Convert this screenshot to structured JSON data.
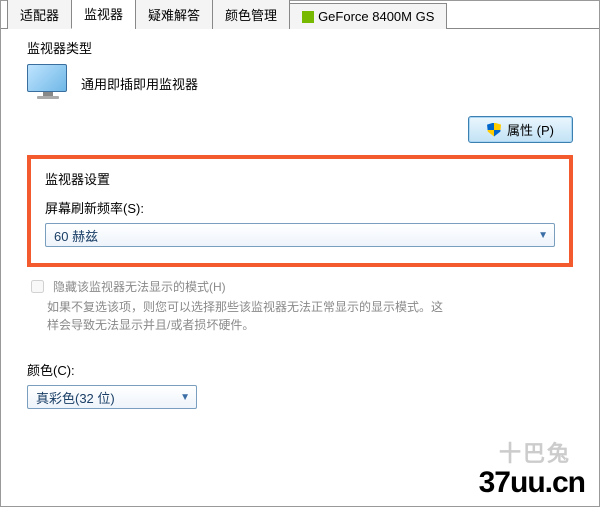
{
  "tabs": {
    "adapter": "适配器",
    "monitor": "监视器",
    "troubleshoot": "疑难解答",
    "color_mgmt": "颜色管理",
    "gpu": "GeForce 8400M GS"
  },
  "monitor_type": {
    "group_label": "监视器类型",
    "name": "通用即插即用监视器",
    "properties_btn": "属性 (P)"
  },
  "monitor_settings": {
    "group_label": "监视器设置",
    "refresh_label": "屏幕刷新频率(S):",
    "refresh_value": "60 赫兹",
    "hide_modes_label": "隐藏该监视器无法显示的模式(H)",
    "hide_modes_checked": false,
    "hint": "如果不复选该项，则您可以选择那些该监视器无法正常显示的显示模式。这样会导致无法显示并且/或者损坏硬件。"
  },
  "color": {
    "label": "颜色(C):",
    "value": "真彩色(32 位)"
  },
  "watermark": {
    "main": "37uu.cn",
    "sub": "十巴兔"
  }
}
